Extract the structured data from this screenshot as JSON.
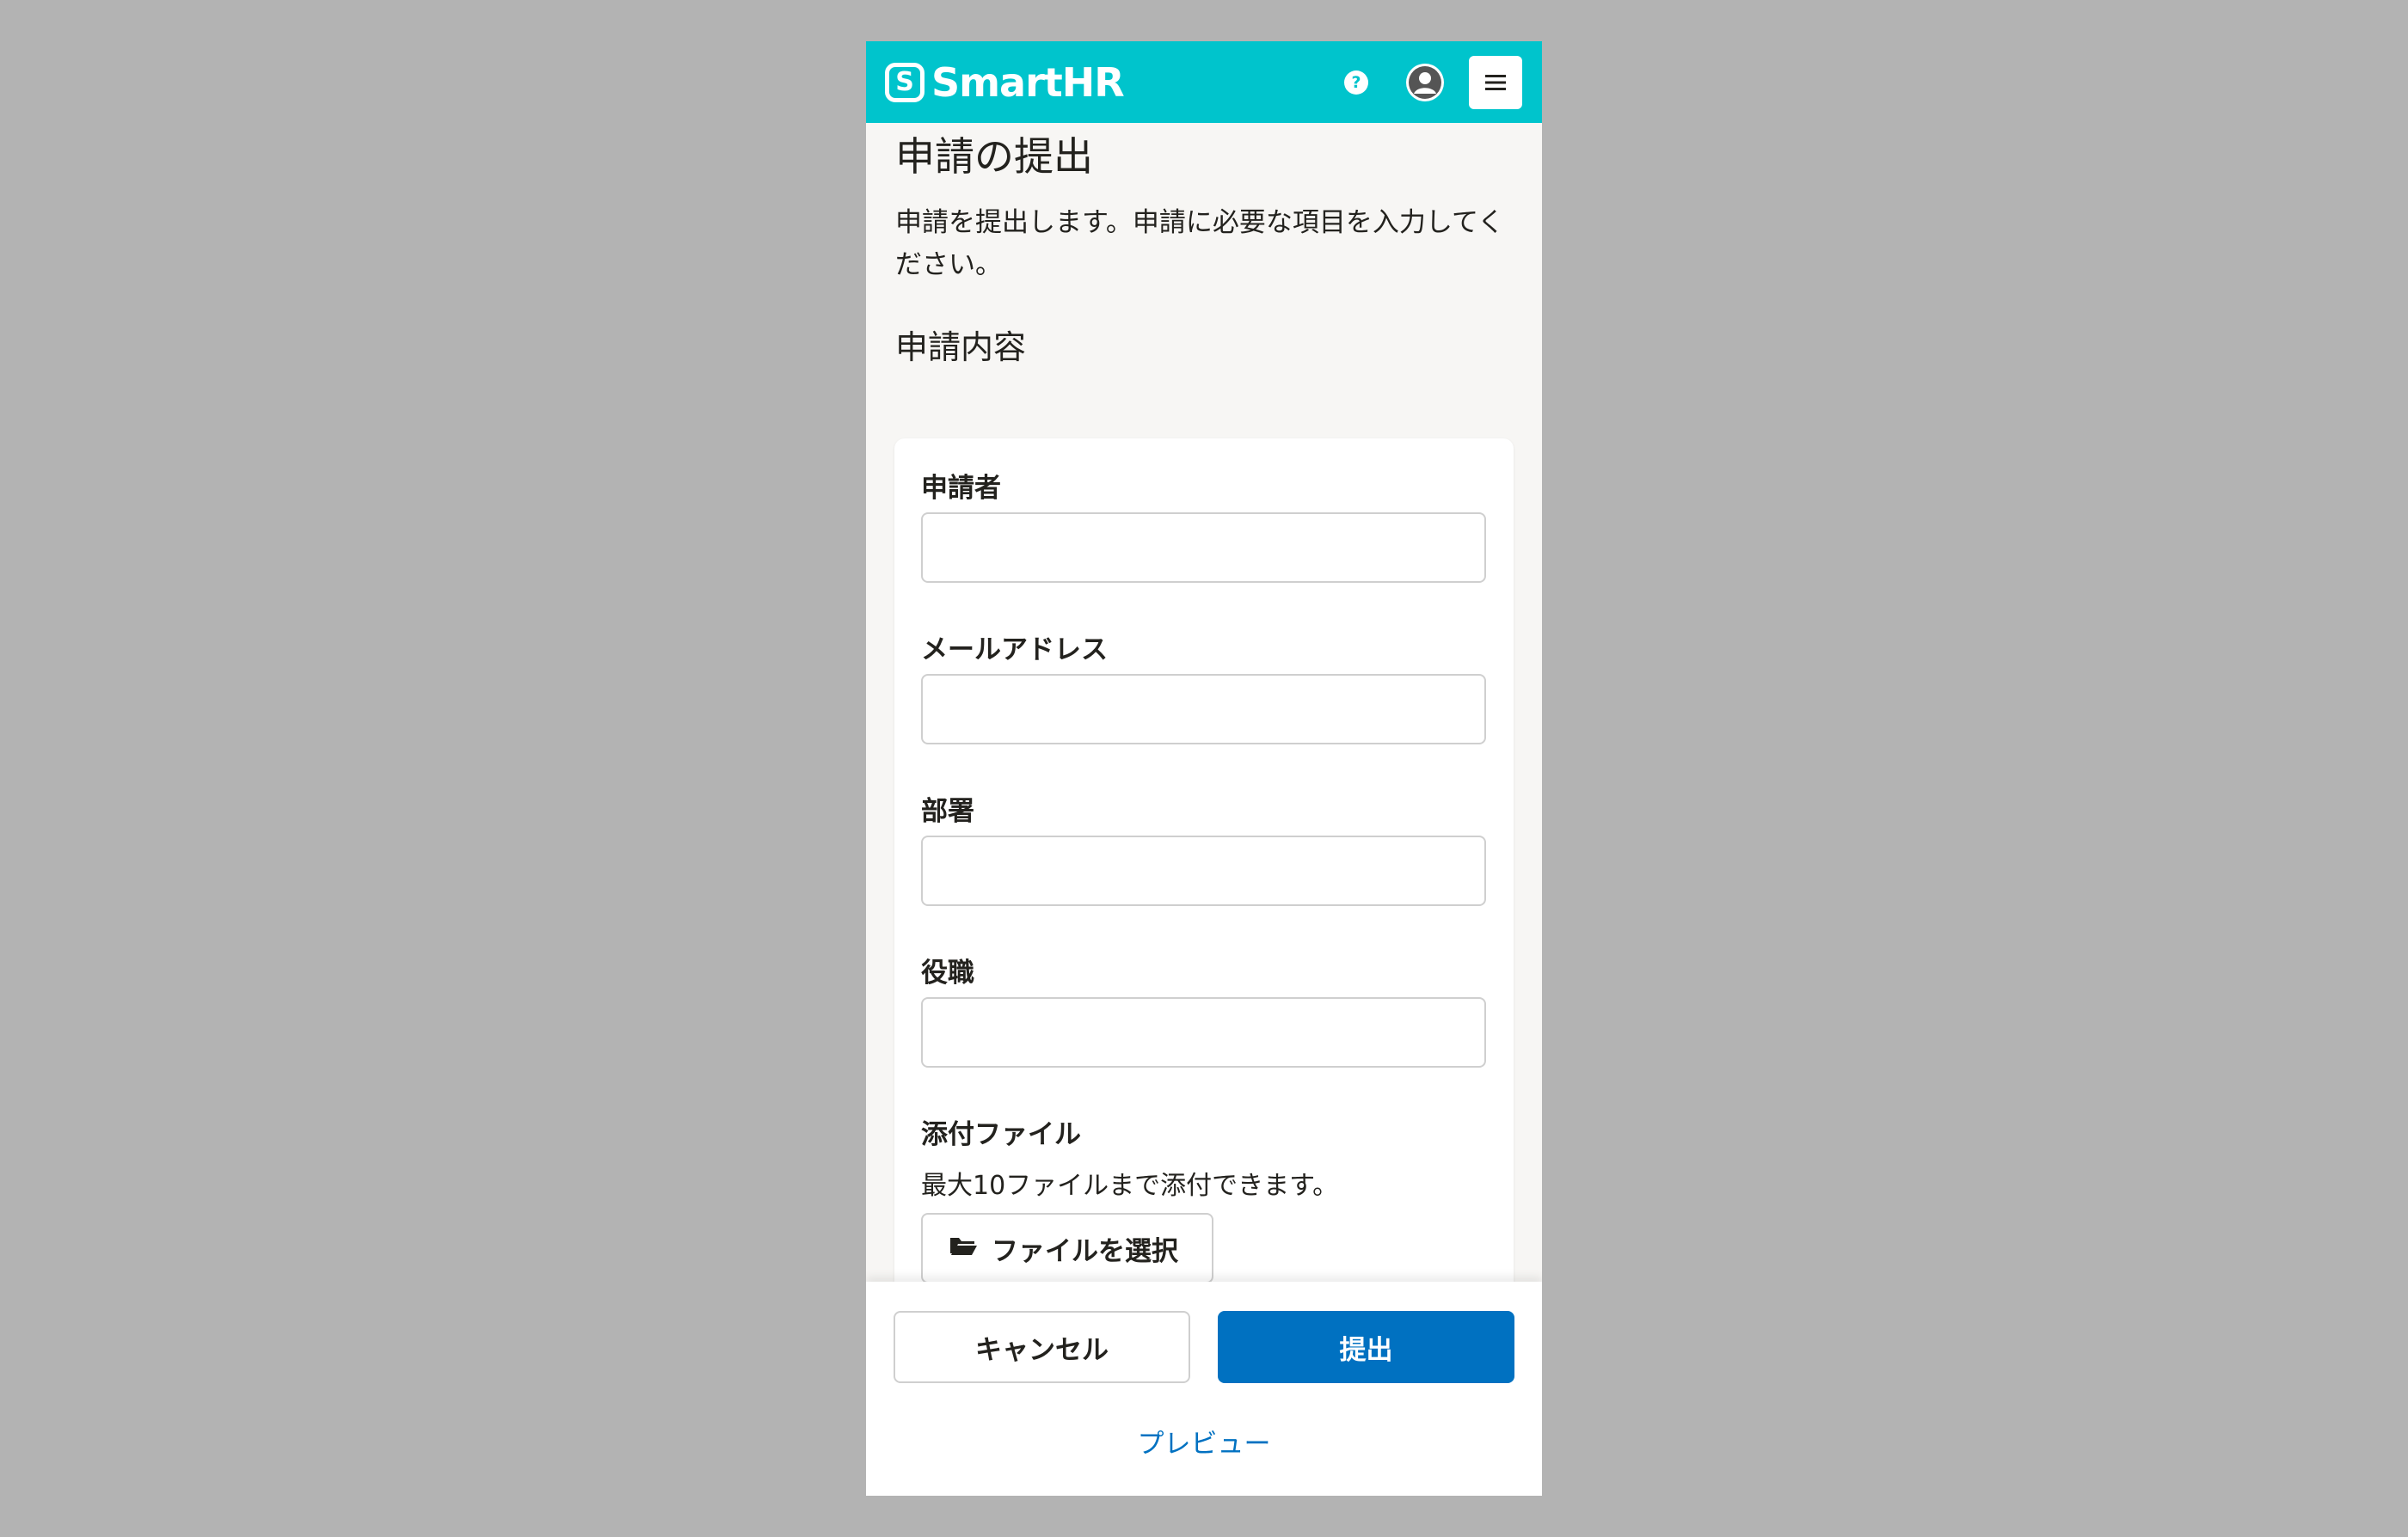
{
  "header": {
    "brand": "SmartHR",
    "logo_letter": "S",
    "help_icon_glyph": "?",
    "icons": [
      "help-icon",
      "account-icon",
      "hamburger-menu-icon"
    ],
    "background_color": "#00c4cc"
  },
  "page": {
    "title": "申請の提出",
    "description": "申請を提出します。申請に必要な項目を入力してください。",
    "section_title": "申請内容"
  },
  "form": {
    "fields": [
      {
        "label": "申請者",
        "value": ""
      },
      {
        "label": "メールアドレス",
        "value": ""
      },
      {
        "label": "部署",
        "value": ""
      },
      {
        "label": "役職",
        "value": ""
      }
    ],
    "attachment": {
      "label": "添付ファイル",
      "help": "最大10ファイルまで添付できます。",
      "button_label": "ファイルを選択",
      "button_icon": "folder-open-icon"
    }
  },
  "footer": {
    "cancel_label": "キャンセル",
    "submit_label": "提出",
    "preview_label": "プレビュー",
    "primary_color": "#0071c1"
  }
}
